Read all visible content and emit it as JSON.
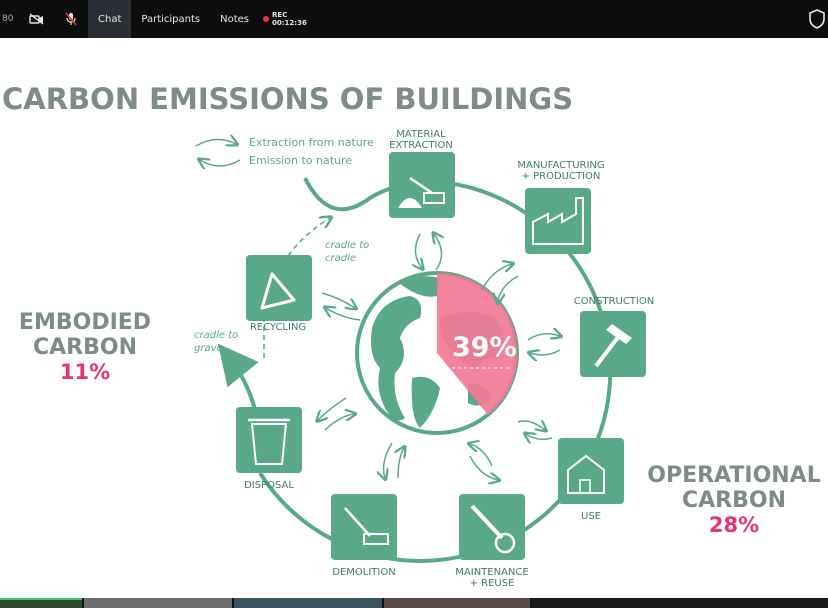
{
  "toolbar": {
    "left_text": "80",
    "items": [
      {
        "icon": "video-off-icon"
      },
      {
        "icon": "mic-off-icon"
      }
    ],
    "chat_label": "Chat",
    "participants_label": "Participants",
    "notes_label": "Notes",
    "rec_label": "REC",
    "rec_time": "00:12:36",
    "right_icon": "shield-icon"
  },
  "slide": {
    "title": "CARBON EMISSIONS OF BUILDINGS",
    "legend": {
      "extraction": "Extraction from nature",
      "emission": "Emission to nature"
    },
    "embodied": {
      "line1": "EMBODIED",
      "line2": "CARBON",
      "percent": "11%"
    },
    "operational": {
      "line1": "OPERATIONAL",
      "line2": "CARBON",
      "percent": "28%"
    },
    "center_percent": "39%",
    "stages": {
      "material1": "MATERIAL",
      "material2": "EXTRACTION",
      "manufacturing1": "MANUFACTURING",
      "manufacturing2": "+ PRODUCTION",
      "construction": "CONSTRUCTION",
      "use": "USE",
      "maintenance1": "MAINTENANCE",
      "maintenance2": "+ REUSE",
      "demolition": "DEMOLITION",
      "disposal": "DISPOSAL",
      "recycling": "RECYCLING"
    },
    "cradle_to_cradle1": "cradle to",
    "cradle_to_cradle2": "cradle",
    "cradle_to_grave1": "cradle to",
    "cradle_to_grave2": "grave"
  },
  "colors": {
    "green": "#5aa88a",
    "gray": "#7f8a8a",
    "pink": "#e8346a",
    "pie": "#f27a95",
    "toolbar_bg": "#0d0d0d"
  }
}
